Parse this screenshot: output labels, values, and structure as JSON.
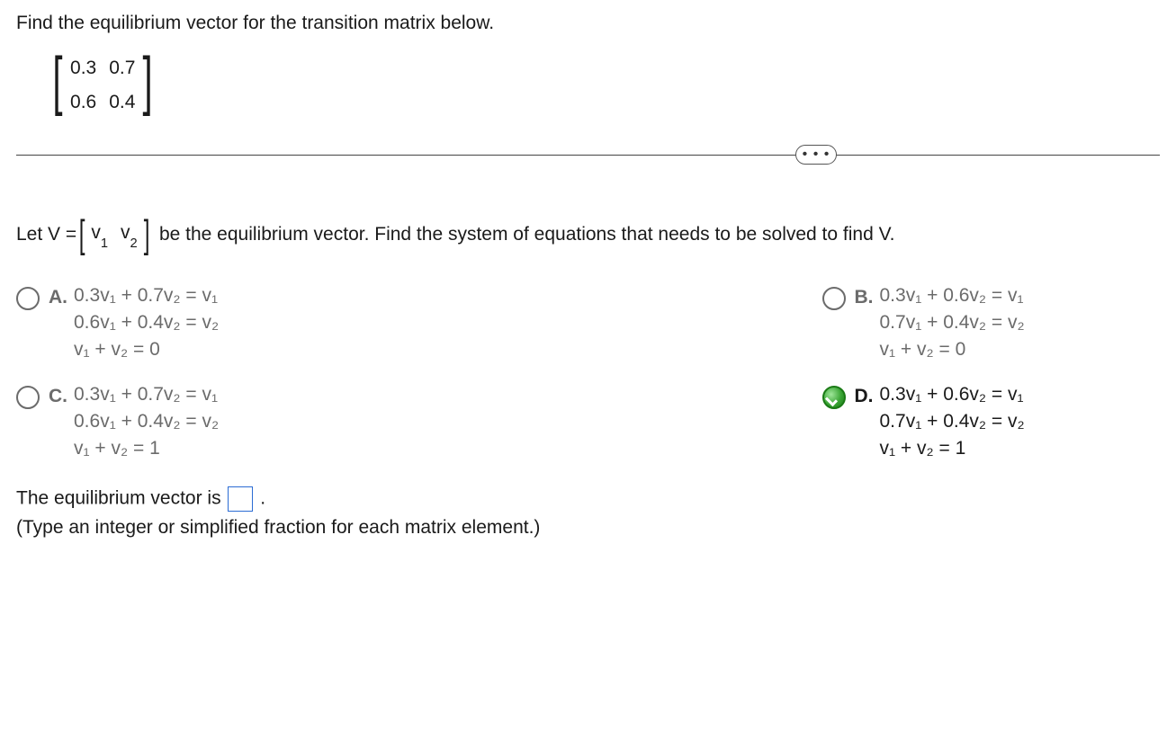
{
  "prompt": "Find the equilibrium vector for the transition matrix below.",
  "matrix": {
    "a11": "0.3",
    "a12": "0.7",
    "a21": "0.6",
    "a22": "0.4"
  },
  "dots": "• • •",
  "let": {
    "pre": "Let V =",
    "v1": "v",
    "s1": "1",
    "v2": "v",
    "s2": "2",
    "post": "be the equilibrium vector. Find the system of equations that needs to be solved to find V."
  },
  "options": {
    "A": {
      "letter": "A.",
      "l1": "0.3v₁ + 0.7v₂ = v₁",
      "l2": "0.6v₁ + 0.4v₂ = v₂",
      "l3": "v₁ + v₂ = 0"
    },
    "B": {
      "letter": "B.",
      "l1": "0.3v₁ + 0.6v₂ = v₁",
      "l2": "0.7v₁ + 0.4v₂ = v₂",
      "l3": "v₁ + v₂ = 0"
    },
    "C": {
      "letter": "C.",
      "l1": "0.3v₁ + 0.7v₂ = v₁",
      "l2": "0.6v₁ + 0.4v₂ = v₂",
      "l3": "v₁ + v₂ = 1"
    },
    "D": {
      "letter": "D.",
      "l1": "0.3v₁ + 0.6v₂ = v₁",
      "l2": "0.7v₁ + 0.4v₂ = v₂",
      "l3": "v₁ + v₂ = 1"
    }
  },
  "selected": "D",
  "answer_prompt_pre": "The equilibrium vector is ",
  "answer_prompt_post": ".",
  "hint": "(Type an integer or simplified fraction for each matrix element.)"
}
